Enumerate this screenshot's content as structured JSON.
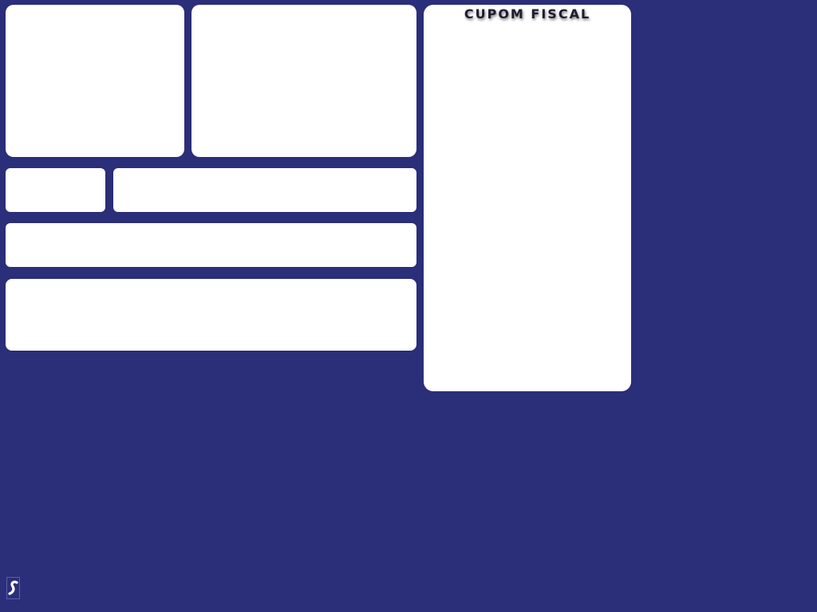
{
  "receipt": {
    "title": "CUPOM FISCAL"
  },
  "logo": {
    "icon": "stylized-s-logo-icon"
  },
  "colors": {
    "background": "#2b2e78",
    "panel": "#ffffff",
    "title_text": "#1d1d2e"
  }
}
